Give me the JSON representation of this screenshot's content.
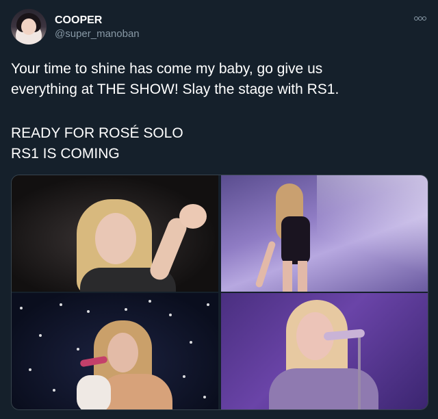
{
  "tweet": {
    "display_name": "COOPER",
    "username": "@super_manoban",
    "more_icon": "more-options-icon",
    "text_lines": [
      "Your time to shine has come my baby, go give us",
      "everything at THE SHOW! Slay the stage with RS1.",
      "READY FOR ROSÉ SOLO",
      "RS1 IS COMING"
    ]
  },
  "colors": {
    "background": "#15202b",
    "text": "#ffffff",
    "secondary_text": "#8899a6",
    "border": "#38444d"
  }
}
